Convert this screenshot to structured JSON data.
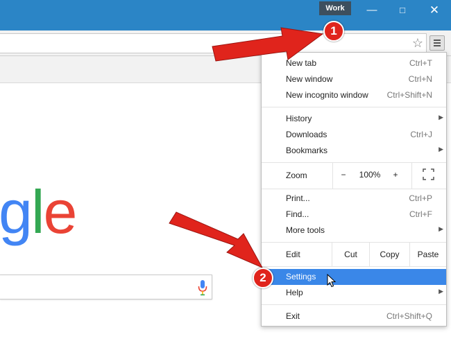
{
  "window": {
    "profile": "Work",
    "minimize_icon": "minimize-icon",
    "maximize_icon": "maximize-icon",
    "close_icon": "close-icon",
    "titlebar_color": "#2b85c6"
  },
  "toolbar": {
    "bookmark_icon": "star-icon",
    "menu_icon": "hamburger-menu-icon"
  },
  "page": {
    "logo_letters": [
      "g",
      "l",
      "e"
    ],
    "logo_colors": [
      "#4285f4",
      "#34a853",
      "#ea4335"
    ],
    "mic_icon": "microphone-icon"
  },
  "menu": {
    "new_tab": {
      "label": "New tab",
      "shortcut": "Ctrl+T"
    },
    "new_window": {
      "label": "New window",
      "shortcut": "Ctrl+N"
    },
    "new_incognito": {
      "label": "New incognito window",
      "shortcut": "Ctrl+Shift+N"
    },
    "history": {
      "label": "History"
    },
    "downloads": {
      "label": "Downloads",
      "shortcut": "Ctrl+J"
    },
    "bookmarks": {
      "label": "Bookmarks"
    },
    "zoom": {
      "label": "Zoom",
      "minus": "−",
      "value": "100%",
      "plus": "+"
    },
    "print": {
      "label": "Print...",
      "shortcut": "Ctrl+P"
    },
    "find": {
      "label": "Find...",
      "shortcut": "Ctrl+F"
    },
    "more_tools": {
      "label": "More tools"
    },
    "edit": {
      "label": "Edit",
      "cut": "Cut",
      "copy": "Copy",
      "paste": "Paste"
    },
    "settings": {
      "label": "Settings"
    },
    "help": {
      "label": "Help"
    },
    "exit": {
      "label": "Exit",
      "shortcut": "Ctrl+Shift+Q"
    },
    "highlight_color": "#3a87e8"
  },
  "annotations": {
    "step1": "1",
    "step2": "2",
    "arrow_color": "#e0241c"
  }
}
